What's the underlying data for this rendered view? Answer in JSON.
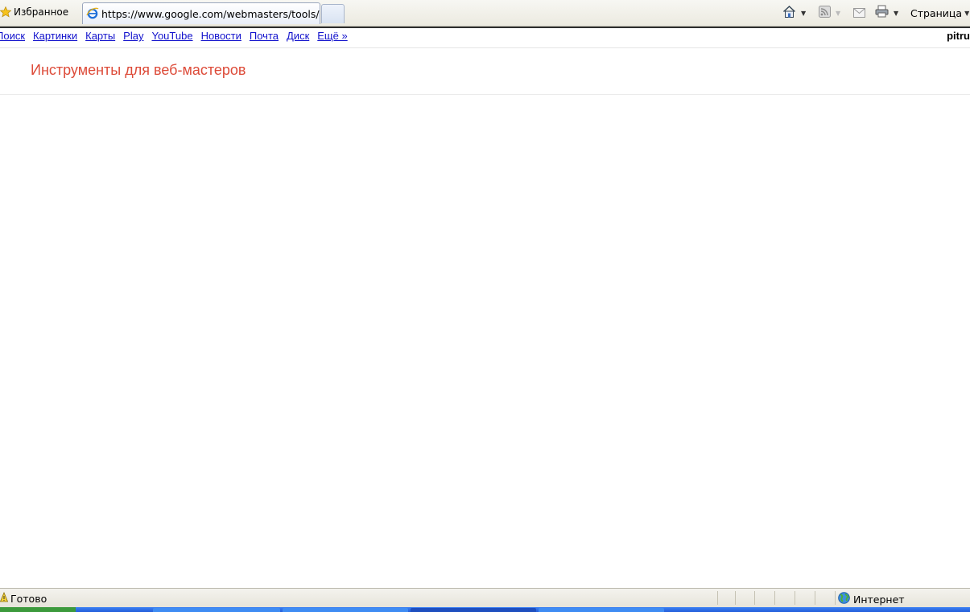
{
  "browser": {
    "favorites_label": "Избранное",
    "tab_url": "https://www.google.com/webmasters/tools/...",
    "page_menu_label": "Страница"
  },
  "gbar": {
    "links": [
      "Поиск",
      "Картинки",
      "Карты",
      "Play",
      "YouTube",
      "Новости",
      "Почта",
      "Диск",
      "Ещё »"
    ],
    "user": "pitru"
  },
  "page": {
    "title": "Инструменты для веб-мастеров"
  },
  "statusbar": {
    "status": "Готово",
    "zone": "Интернет"
  },
  "colors": {
    "title": "#dd4b39",
    "link": "#1111cc"
  }
}
